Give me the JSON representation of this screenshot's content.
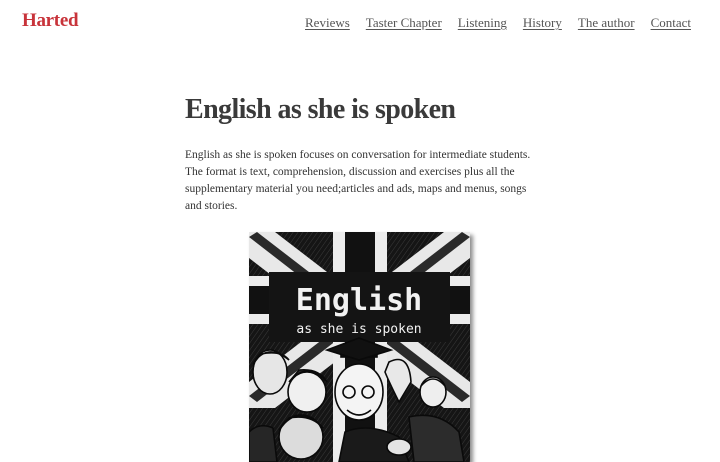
{
  "site": {
    "logo": "Harted"
  },
  "nav": {
    "items": [
      {
        "label": "Reviews"
      },
      {
        "label": "Taster Chapter"
      },
      {
        "label": "Listening"
      },
      {
        "label": "History"
      },
      {
        "label": "The author"
      },
      {
        "label": "Contact"
      }
    ]
  },
  "page": {
    "title": "English as she is spoken",
    "intro": "English as she is spoken focuses on conversation for intermediate students. The format is text, comprehension, discussion and exercises plus all the supplementary material you need;articles and ads, maps and menus, songs and stories."
  },
  "cover": {
    "title_line1": "English",
    "title_line2": "as she is spoken"
  },
  "colors": {
    "brand": "#c8333a",
    "text": "#333333",
    "nav_link": "#555555"
  }
}
